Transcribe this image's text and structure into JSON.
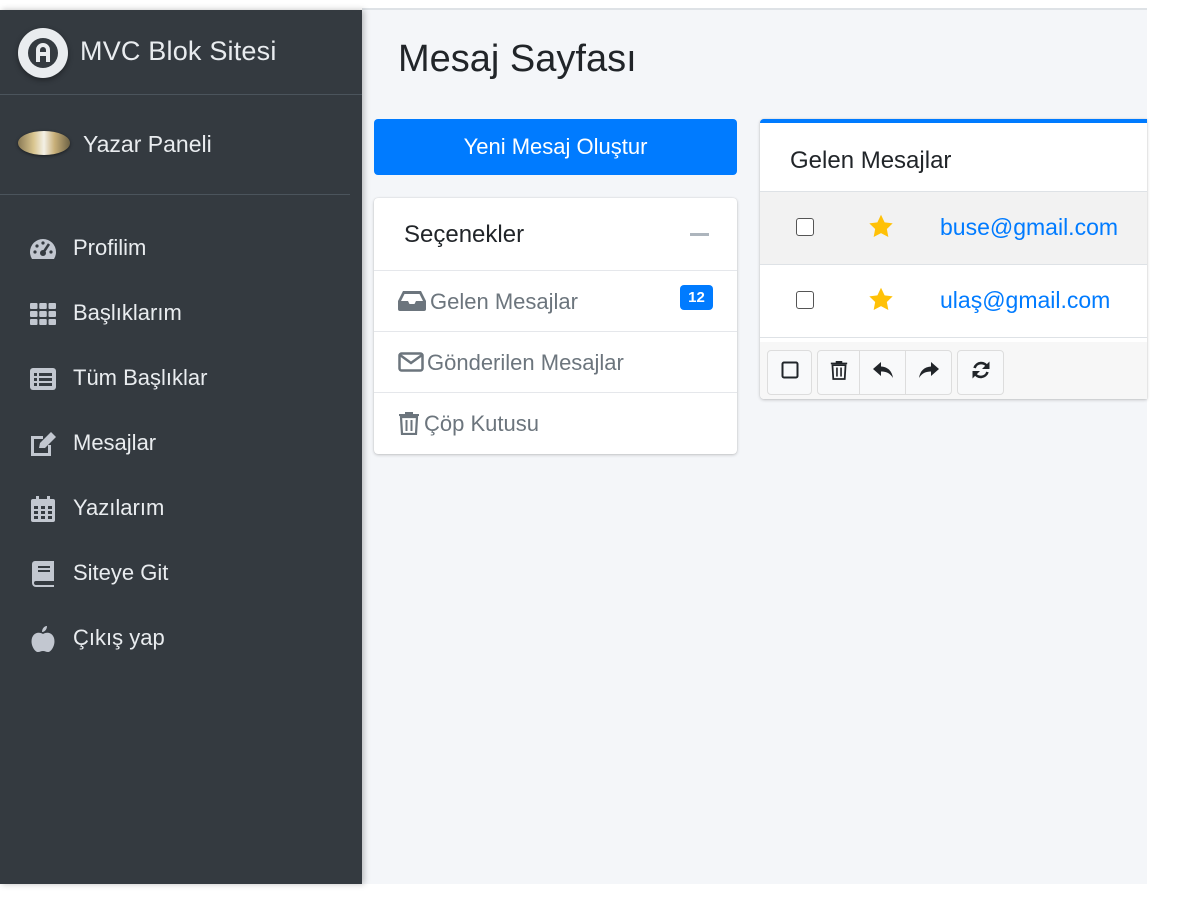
{
  "brand": {
    "title": "MVC Blok Sitesi",
    "logo_icon": "letter-a-logo-icon"
  },
  "user": {
    "name": "Yazar Paneli"
  },
  "sidebar": {
    "items": [
      {
        "label": "Profilim",
        "icon": "tachometer-icon"
      },
      {
        "label": "Başlıklarım",
        "icon": "grid-icon"
      },
      {
        "label": "Tüm Başlıklar",
        "icon": "list-alt-icon"
      },
      {
        "label": "Mesajlar",
        "icon": "edit-icon"
      },
      {
        "label": "Yazılarım",
        "icon": "calendar-icon"
      },
      {
        "label": "Siteye Git",
        "icon": "book-icon"
      },
      {
        "label": "Çıkış yap",
        "icon": "apple-icon"
      }
    ]
  },
  "page": {
    "title": "Mesaj Sayfası"
  },
  "new_message_button": "Yeni Mesaj Oluştur",
  "options": {
    "title": "Seçenekler",
    "items": [
      {
        "label": "Gelen Mesajlar",
        "icon": "inbox-icon",
        "badge": "12"
      },
      {
        "label": "Gönderilen Mesajlar",
        "icon": "envelope-icon"
      },
      {
        "label": "Çöp Kutusu",
        "icon": "trash-icon"
      }
    ]
  },
  "inbox": {
    "title": "Gelen Mesajlar",
    "messages": [
      {
        "from": "buse@gmail.com",
        "starred": true
      },
      {
        "from": "ulaş@gmail.com",
        "starred": true
      }
    ],
    "toolbar": [
      "check-square-icon",
      "trash-icon",
      "reply-icon",
      "share-icon",
      "refresh-icon"
    ]
  },
  "colors": {
    "primary": "#007bff",
    "sidebar": "#343a40",
    "star": "#ffc107",
    "content_bg": "#f4f6f9"
  }
}
